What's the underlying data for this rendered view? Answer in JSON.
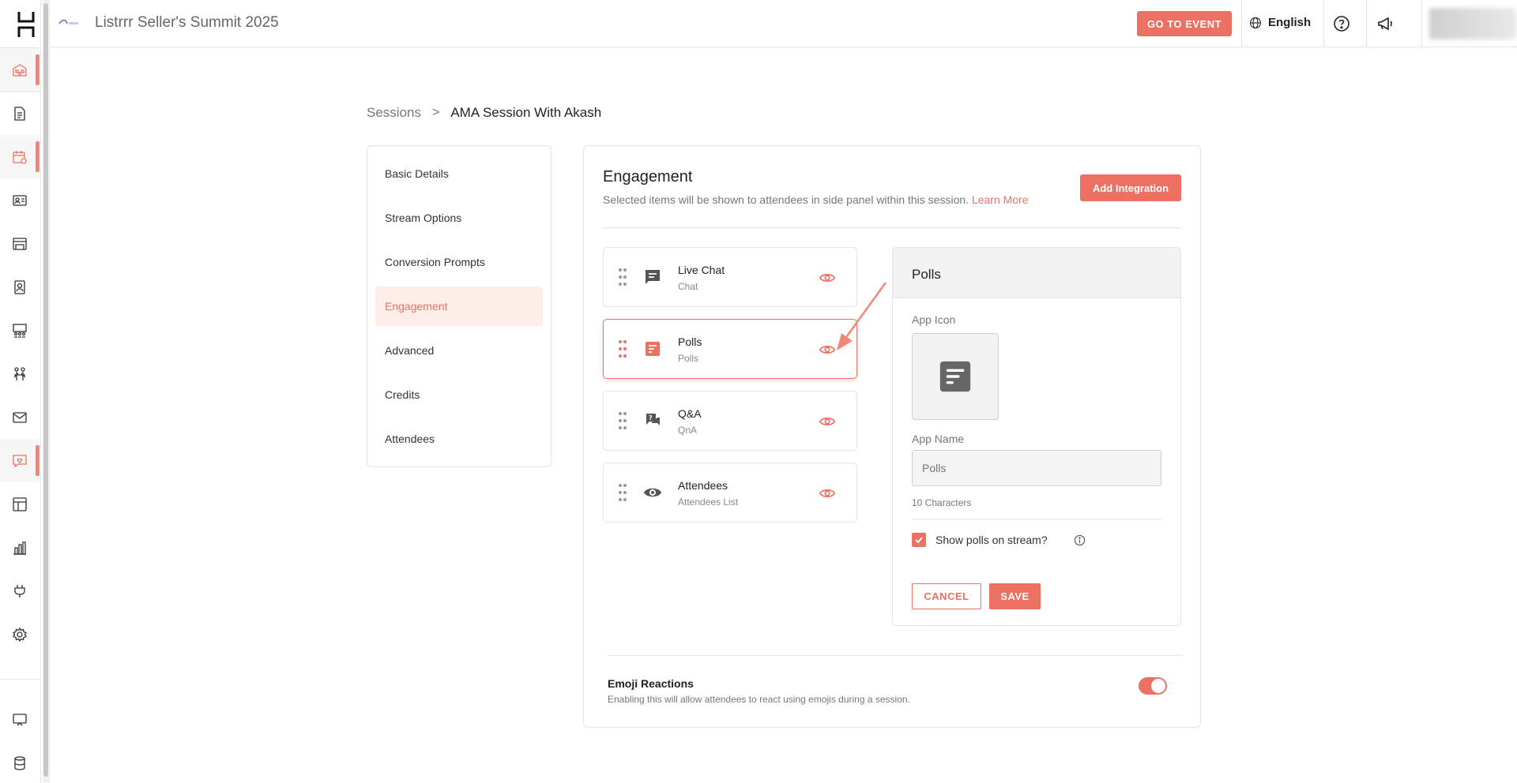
{
  "topbar": {
    "event_title": "Listrrr Seller's Summit 2025",
    "go_to_event_label": "GO TO EVENT",
    "language": "English"
  },
  "breadcrumb": {
    "parent": "Sessions",
    "separator": ">",
    "current": "AMA Session With Akash"
  },
  "subnav": {
    "items": [
      {
        "label": "Basic Details"
      },
      {
        "label": "Stream Options"
      },
      {
        "label": "Conversion Prompts"
      },
      {
        "label": "Engagement",
        "active": true
      },
      {
        "label": "Advanced"
      },
      {
        "label": "Credits"
      },
      {
        "label": "Attendees"
      }
    ]
  },
  "engagement": {
    "title": "Engagement",
    "description": "Selected items will be shown to attendees in side panel within this session.",
    "learn_more": "Learn More",
    "add_integration_label": "Add Integration",
    "apps": [
      {
        "name": "Live Chat",
        "sub": "Chat",
        "icon": "chat-icon"
      },
      {
        "name": "Polls",
        "sub": "Polls",
        "icon": "poll-icon",
        "selected": true
      },
      {
        "name": "Q&A",
        "sub": "QnA",
        "icon": "qna-icon"
      },
      {
        "name": "Attendees",
        "sub": "Attendees List",
        "icon": "eye-icon"
      }
    ]
  },
  "edit_panel": {
    "title": "Polls",
    "app_icon_label": "App Icon",
    "app_name_label": "App Name",
    "app_name_value": "Polls",
    "char_count": "10 Characters",
    "show_on_stream_label": "Show polls on stream?",
    "show_on_stream_checked": true,
    "cancel_label": "CANCEL",
    "save_label": "SAVE"
  },
  "emoji": {
    "title": "Emoji Reactions",
    "description": "Enabling this will allow attendees to react using emojis during a session.",
    "enabled": true
  },
  "colors": {
    "accent": "#ec7163",
    "accent_light": "#fdeeea"
  }
}
